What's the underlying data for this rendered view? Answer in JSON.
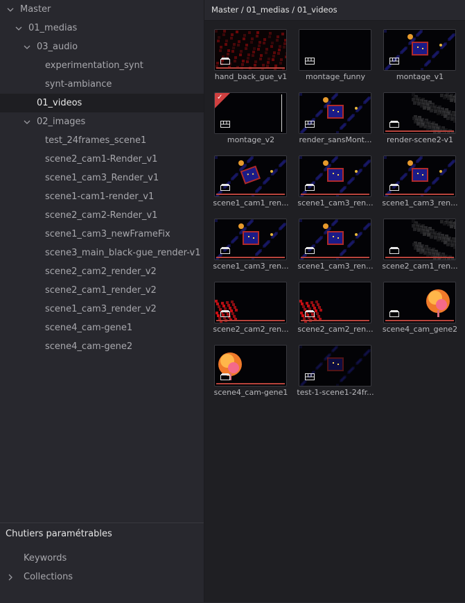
{
  "breadcrumb": "Master / 01_medias / 01_videos",
  "tree": [
    {
      "label": "Master",
      "expanded": true
    },
    {
      "label": "01_medias",
      "expanded": true
    },
    {
      "label": "03_audio",
      "expanded": true
    },
    {
      "label": "experimentation_synt"
    },
    {
      "label": "synt-ambiance"
    },
    {
      "label": "01_videos",
      "selected": true
    },
    {
      "label": "02_images",
      "expanded": true
    },
    {
      "label": "test_24frames_scene1"
    },
    {
      "label": "scene2_cam1-Render_v1"
    },
    {
      "label": "scene1_cam3_Render_v1"
    },
    {
      "label": "scene1-cam1-render_v1"
    },
    {
      "label": "scene2_cam2-Render_v1"
    },
    {
      "label": "scene1_cam3_newFrameFix"
    },
    {
      "label": "scene3_main_black-gue_render-v1"
    },
    {
      "label": "scene2_cam2_render_v2"
    },
    {
      "label": "scene2_cam1_render_v2"
    },
    {
      "label": "scene1_cam3_render_v2"
    },
    {
      "label": "scene4_cam-gene1"
    },
    {
      "label": "scene4_cam-gene2"
    }
  ],
  "smart_bins": {
    "title": "Chutiers paramétrables",
    "items": [
      {
        "label": "Keywords"
      },
      {
        "label": "Collections",
        "collapsed": true
      }
    ]
  },
  "clips": [
    {
      "label": "hand_back_gue_v1",
      "type": "clip",
      "scene": "red-texture"
    },
    {
      "label": "montage_funny",
      "type": "timeline",
      "scene": "black"
    },
    {
      "label": "montage_v1",
      "type": "timeline",
      "scene": "corridor-frame"
    },
    {
      "label": "montage_v2",
      "type": "timeline",
      "scene": "black",
      "flagged": true
    },
    {
      "label": "render_sansMont...",
      "type": "timeline",
      "scene": "corridor-frame"
    },
    {
      "label": "render-scene2-v1",
      "type": "clip",
      "scene": "gray-texture"
    },
    {
      "label": "scene1_cam1_ren...",
      "type": "clip",
      "scene": "corridor-tilt"
    },
    {
      "label": "scene1_cam3_ren...",
      "type": "clip",
      "scene": "corridor-frame"
    },
    {
      "label": "scene1_cam3_ren...",
      "type": "clip",
      "scene": "corridor-frame"
    },
    {
      "label": "scene1_cam3_ren...",
      "type": "clip",
      "scene": "corridor-frame"
    },
    {
      "label": "scene1_cam3_ren...",
      "type": "clip",
      "scene": "corridor-frame"
    },
    {
      "label": "scene2_cam1_ren...",
      "type": "clip",
      "scene": "gray-texture"
    },
    {
      "label": "scene2_cam2_ren...",
      "type": "clip",
      "scene": "red-corner"
    },
    {
      "label": "scene2_cam2_ren...",
      "type": "clip",
      "scene": "red-corner"
    },
    {
      "label": "scene4_cam_gene2",
      "type": "clip",
      "scene": "tree-right"
    },
    {
      "label": "scene4_cam-gene1",
      "type": "clip",
      "scene": "tree-left"
    },
    {
      "label": "test-1-scene1-24fr...",
      "type": "timeline",
      "scene": "corridor-dark"
    }
  ],
  "colors": {
    "accent_red": "#d04040",
    "audio_bar": "#b8443c",
    "selected_bg": "#1e1e22"
  },
  "icons": {
    "chevron_expanded": "chevron-down-icon",
    "chevron_collapsed": "chevron-right-icon",
    "clip_type": "film-clip-icon",
    "timeline_type": "timeline-icon"
  }
}
